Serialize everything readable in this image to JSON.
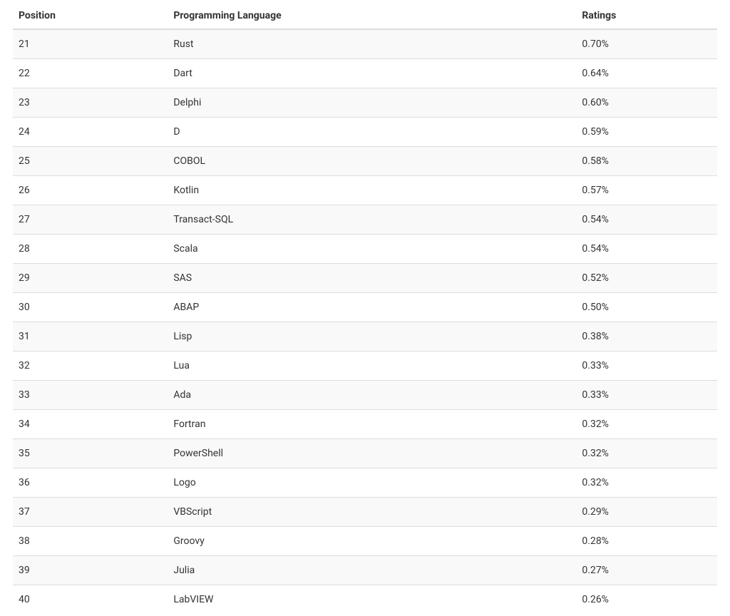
{
  "table": {
    "headers": {
      "position": "Position",
      "language": "Programming Language",
      "ratings": "Ratings"
    },
    "rows": [
      {
        "position": "21",
        "language": "Rust",
        "ratings": "0.70%"
      },
      {
        "position": "22",
        "language": "Dart",
        "ratings": "0.64%"
      },
      {
        "position": "23",
        "language": "Delphi",
        "ratings": "0.60%"
      },
      {
        "position": "24",
        "language": "D",
        "ratings": "0.59%"
      },
      {
        "position": "25",
        "language": "COBOL",
        "ratings": "0.58%"
      },
      {
        "position": "26",
        "language": "Kotlin",
        "ratings": "0.57%"
      },
      {
        "position": "27",
        "language": "Transact-SQL",
        "ratings": "0.54%"
      },
      {
        "position": "28",
        "language": "Scala",
        "ratings": "0.54%"
      },
      {
        "position": "29",
        "language": "SAS",
        "ratings": "0.52%"
      },
      {
        "position": "30",
        "language": "ABAP",
        "ratings": "0.50%"
      },
      {
        "position": "31",
        "language": "Lisp",
        "ratings": "0.38%"
      },
      {
        "position": "32",
        "language": "Lua",
        "ratings": "0.33%"
      },
      {
        "position": "33",
        "language": "Ada",
        "ratings": "0.33%"
      },
      {
        "position": "34",
        "language": "Fortran",
        "ratings": "0.32%"
      },
      {
        "position": "35",
        "language": "PowerShell",
        "ratings": "0.32%"
      },
      {
        "position": "36",
        "language": "Logo",
        "ratings": "0.32%"
      },
      {
        "position": "37",
        "language": "VBScript",
        "ratings": "0.29%"
      },
      {
        "position": "38",
        "language": "Groovy",
        "ratings": "0.28%"
      },
      {
        "position": "39",
        "language": "Julia",
        "ratings": "0.27%"
      },
      {
        "position": "40",
        "language": "LabVIEW",
        "ratings": "0.26%"
      }
    ]
  }
}
